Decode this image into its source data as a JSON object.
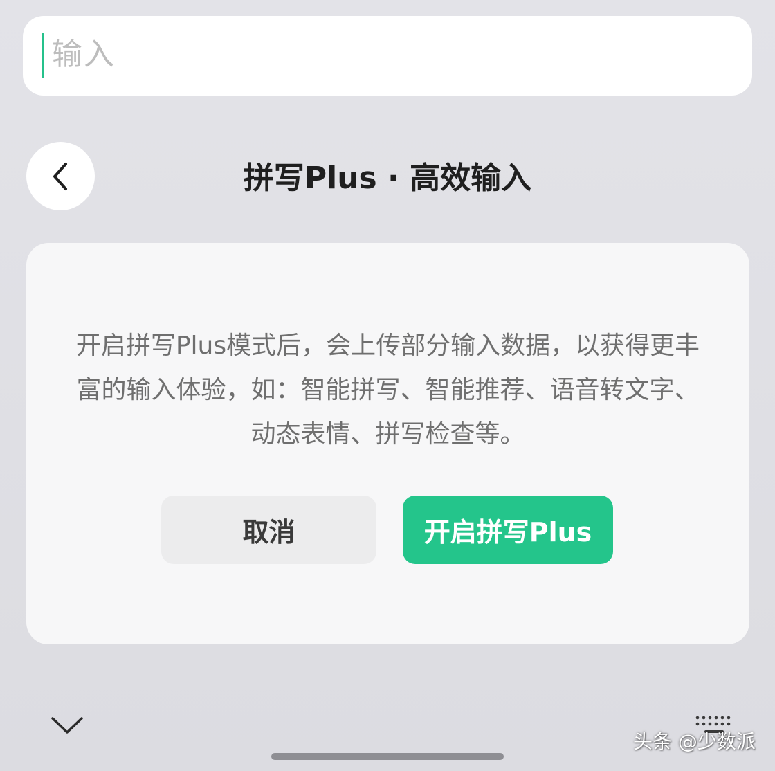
{
  "input": {
    "placeholder": "输入"
  },
  "header": {
    "back_icon": "chevron-left-icon",
    "title": "拼写Plus · 高效输入"
  },
  "dialog": {
    "description": "开启拼写Plus模式后，会上传部分输入数据，以获得更丰富的输入体验，如：智能拼写、智能推荐、语音转文字、动态表情、拼写检查等。",
    "cancel_label": "取消",
    "confirm_label": "开启拼写Plus"
  },
  "footer": {
    "collapse_icon": "chevron-down-icon",
    "keyboard_icon": "keyboard-grid-icon"
  },
  "watermark": "头条 @少数派",
  "colors": {
    "accent": "#24c58b",
    "caret": "#25c18b",
    "background": "#e0e0e5",
    "card": "#f7f7f8",
    "cancel_button": "#ececed"
  }
}
